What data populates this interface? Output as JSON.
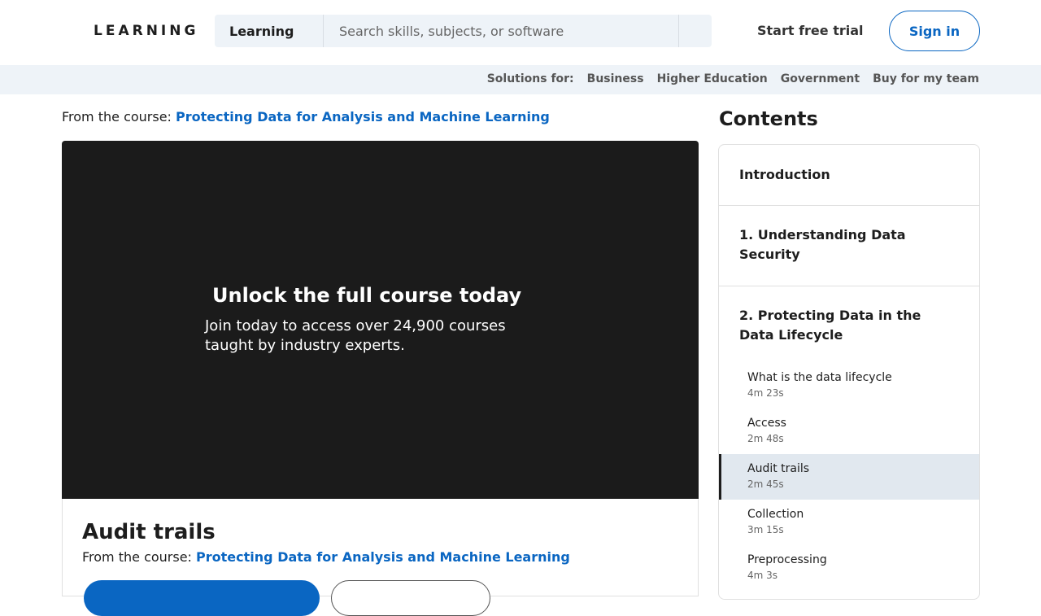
{
  "header": {
    "brand": "LEARNING",
    "search_scope": "Learning",
    "search_placeholder": "Search skills, subjects, or software",
    "start_trial": "Start free trial",
    "sign_in": "Sign in"
  },
  "subnav": {
    "label": "Solutions for:",
    "items": [
      "Business",
      "Higher Education",
      "Government",
      "Buy for my team"
    ]
  },
  "course": {
    "from_label": "From the course:",
    "title": "Protecting Data for Analysis and Machine Learning"
  },
  "video": {
    "title": "Unlock the full course today",
    "subtitle": "Join today to access over 24,900 courses taught by industry experts."
  },
  "lesson": {
    "title": "Audit trails"
  },
  "contents": {
    "heading": "Contents",
    "sections": [
      {
        "label": "Introduction"
      },
      {
        "label": "1. Understanding Data Security"
      },
      {
        "label": "2. Protecting Data in the Data Lifecycle",
        "lessons": [
          {
            "title": "What is the data lifecycle",
            "duration": "4m 23s"
          },
          {
            "title": "Access",
            "duration": "2m 48s"
          },
          {
            "title": "Audit trails",
            "duration": "2m 45s"
          },
          {
            "title": "Collection",
            "duration": "3m 15s"
          },
          {
            "title": "Preprocessing",
            "duration": "4m 3s"
          }
        ]
      }
    ]
  },
  "colors": {
    "accent": "#0a66c2",
    "video_bg": "#1b1b1b",
    "subnav_bg": "#eef3f8",
    "active_lesson_bg": "#e1e8ef"
  }
}
